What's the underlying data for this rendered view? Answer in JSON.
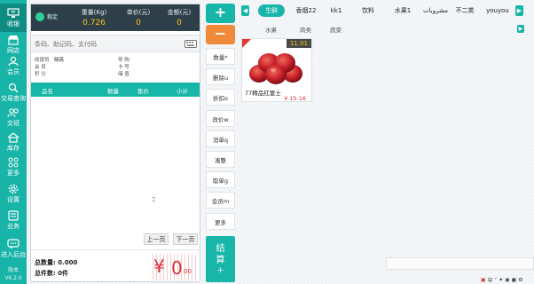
{
  "sidebar": {
    "items": [
      {
        "label": "收银",
        "icon": "monitor-icon"
      },
      {
        "label": "网店",
        "icon": "shop-icon"
      },
      {
        "label": "会员",
        "icon": "member-icon"
      },
      {
        "label": "交易查询",
        "icon": "search-icon"
      },
      {
        "label": "交班",
        "icon": "handover-icon"
      },
      {
        "label": "库存",
        "icon": "home-icon"
      },
      {
        "label": "更多",
        "icon": "more-icon"
      },
      {
        "label": "设置",
        "icon": "gear-icon"
      },
      {
        "label": "业务",
        "icon": "business-icon"
      },
      {
        "label": "进入后台",
        "icon": "chat-icon"
      }
    ],
    "version_label": "版本",
    "version": "V6.2.0"
  },
  "scale": {
    "status": "稳定",
    "weight_label": "重量(Kg)",
    "weight_value": "0.726",
    "unit_price_label": "单价(元)",
    "unit_price_value": "0",
    "amount_label": "金额(元)",
    "amount_value": "0"
  },
  "search": {
    "placeholder": "条码、助记码、支付码"
  },
  "info": {
    "cashier_label": "收银员",
    "cashier_value": "晓亮",
    "discount_label": "导 购",
    "member_label": "会 员",
    "card_label": "卡 号",
    "points_label": "积 分",
    "balance_label": "储 值"
  },
  "table": {
    "columns": [
      "品名",
      "数量",
      "售价",
      "小计"
    ]
  },
  "pager": {
    "prev": "上一页",
    "next": "下一页"
  },
  "totals": {
    "qty_label": "总数量:",
    "qty_value": "0.000",
    "count_label": "总件数:",
    "count_value": "0件",
    "amount_symbol": "¥",
    "amount_value": "0",
    "amount_cents": "00"
  },
  "actions": {
    "plus": "+",
    "minus": "−",
    "buttons": [
      "数量*",
      "删除u",
      "折扣o",
      "改价w",
      "消单q",
      "凑整",
      "取单g",
      "会员m",
      "更多"
    ],
    "checkout_line1": "结",
    "checkout_line2": "算",
    "checkout_plus": "+"
  },
  "categories": {
    "tabs": [
      "生鲜",
      "香烟22",
      "kk1",
      "饮料",
      "水果1",
      "مشروبات",
      "不二类",
      "youyou"
    ],
    "active": "生鲜",
    "subtabs": [
      "水果",
      "肉类",
      "蔬菜"
    ]
  },
  "product": {
    "badge": "11.01",
    "name": "77精品红富士",
    "price": "¥ 15.16",
    "image": "red-apples-image"
  },
  "tray": {
    "items": [
      "中",
      "ᐟ",
      "✦",
      "◉",
      "▣",
      "⚙"
    ]
  },
  "colors": {
    "accent": "#18b6a9",
    "orange": "#f08a38",
    "price_red": "#e0313a",
    "weight_yellow": "#f5c518"
  }
}
